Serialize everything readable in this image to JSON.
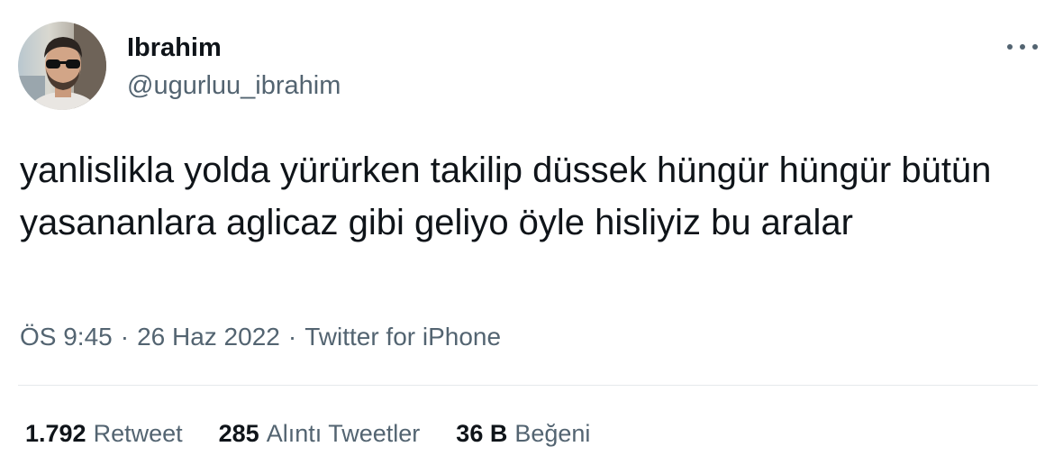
{
  "user": {
    "display_name": "Ibrahim",
    "handle": "@ugurluu_ibrahim"
  },
  "tweet": {
    "text": "yanlislikla yolda yürürken takilip düssek hüngür hüngür bütün yasananlara aglicaz gibi geliyo öyle hisliyiz bu aralar"
  },
  "meta": {
    "time": "ÖS 9:45",
    "separator": "·",
    "date": "26 Haz 2022",
    "source": "Twitter for iPhone"
  },
  "stats": {
    "retweets": {
      "count": "1.792",
      "label": "Retweet"
    },
    "quotes": {
      "count": "285",
      "label": "Alıntı Tweetler"
    },
    "likes": {
      "count": "36 B",
      "label": "Beğeni"
    }
  },
  "icons": {
    "more": "more-horizontal-icon",
    "avatar": "profile-photo"
  },
  "colors": {
    "text_primary": "#0f1419",
    "text_secondary": "#536471",
    "divider": "#e5e9ec"
  }
}
